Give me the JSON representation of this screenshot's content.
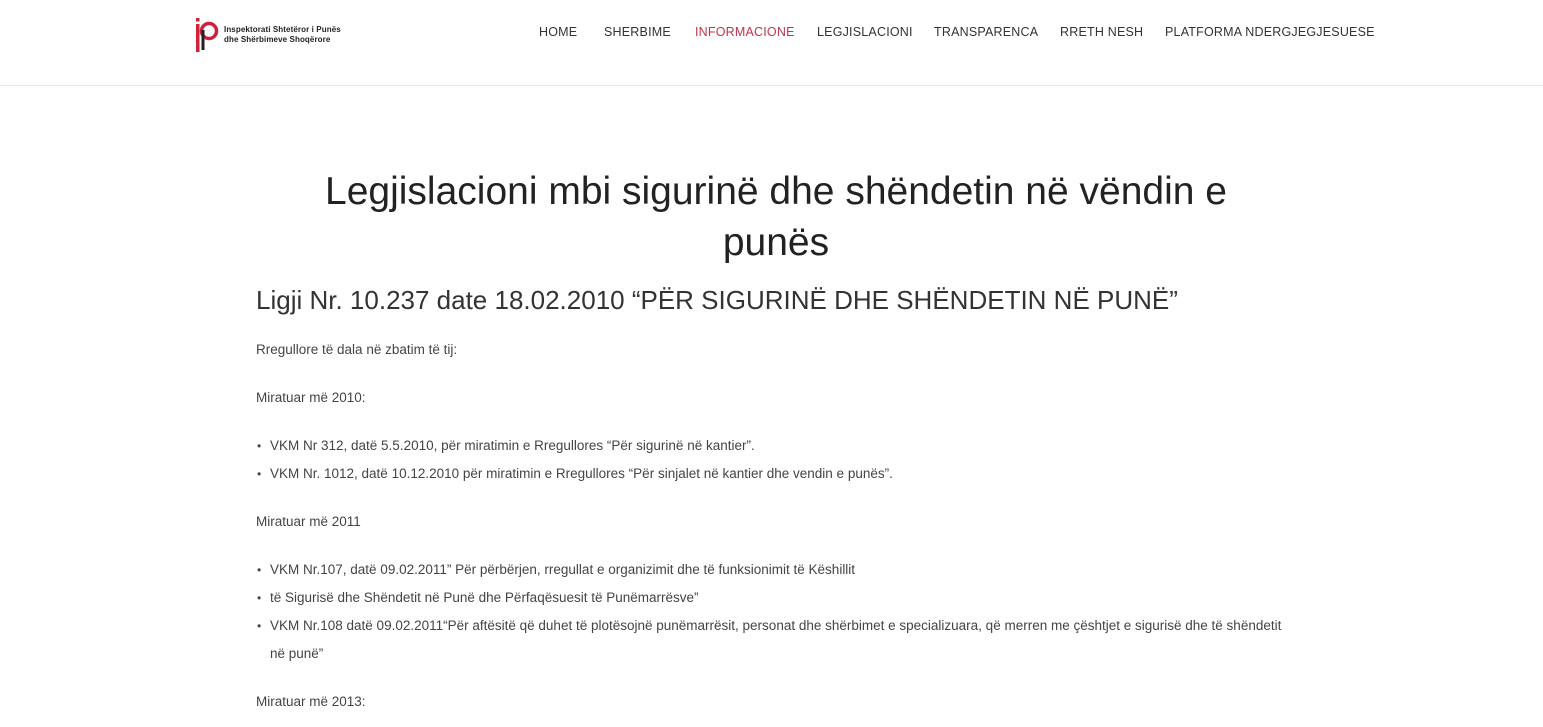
{
  "logo": {
    "line1": "Inspektorati Shtetëror i Punës",
    "line2": "dhe Shërbimeve Shoqërore",
    "brand_color": "#d0213a"
  },
  "nav": {
    "items": [
      {
        "label": "HOME"
      },
      {
        "label": "SHERBIME"
      },
      {
        "label": "INFORMACIONE",
        "active": true
      },
      {
        "label": "LEGJISLACIONI"
      },
      {
        "label": "TRANSPARENCA"
      },
      {
        "label": "RRETH NESH"
      },
      {
        "label": "PLATFORMA NDERGJEGJESUESE"
      }
    ],
    "active_color": "#c0344a"
  },
  "content": {
    "page_title_line1": "Legjislacioni mbi sigurinë dhe shëndetin në vëndin e",
    "page_title_line2": "punës",
    "law_title": "Ligji Nr. 10.237 date 18.02.2010 “PËR SIGURINË DHE SHËNDETIN NË PUNË”",
    "intro": "Rregullore të dala në zbatim të tij:",
    "sections": [
      {
        "heading": "Miratuar më 2010:",
        "items": [
          "VKM Nr 312, datë 5.5.2010, për miratimin e Rregullores “Për sigurinë në kantier”.",
          "VKM Nr. 1012, datë 10.12.2010 për miratimin e Rregullores “Për sinjalet në kantier dhe vendin e punës”."
        ]
      },
      {
        "heading": "Miratuar më 2011",
        "items": [
          "VKM Nr.107, datë 09.02.2011” Për përbërjen, rregullat e organizimit dhe të funksionimit të Këshillit",
          "të Sigurisë dhe Shëndetit në Punë dhe Përfaqësuesit të Punëmarrësve”",
          "VKM Nr.108 datë 09.02.2011“Për aftësitë që duhet të plotësojnë punëmarrësit, personat dhe shërbimet e specializuara, që merren me çështjet e sigurisë dhe të shëndetit në punë”"
        ]
      },
      {
        "heading": "Miratuar më 2013:"
      }
    ]
  }
}
